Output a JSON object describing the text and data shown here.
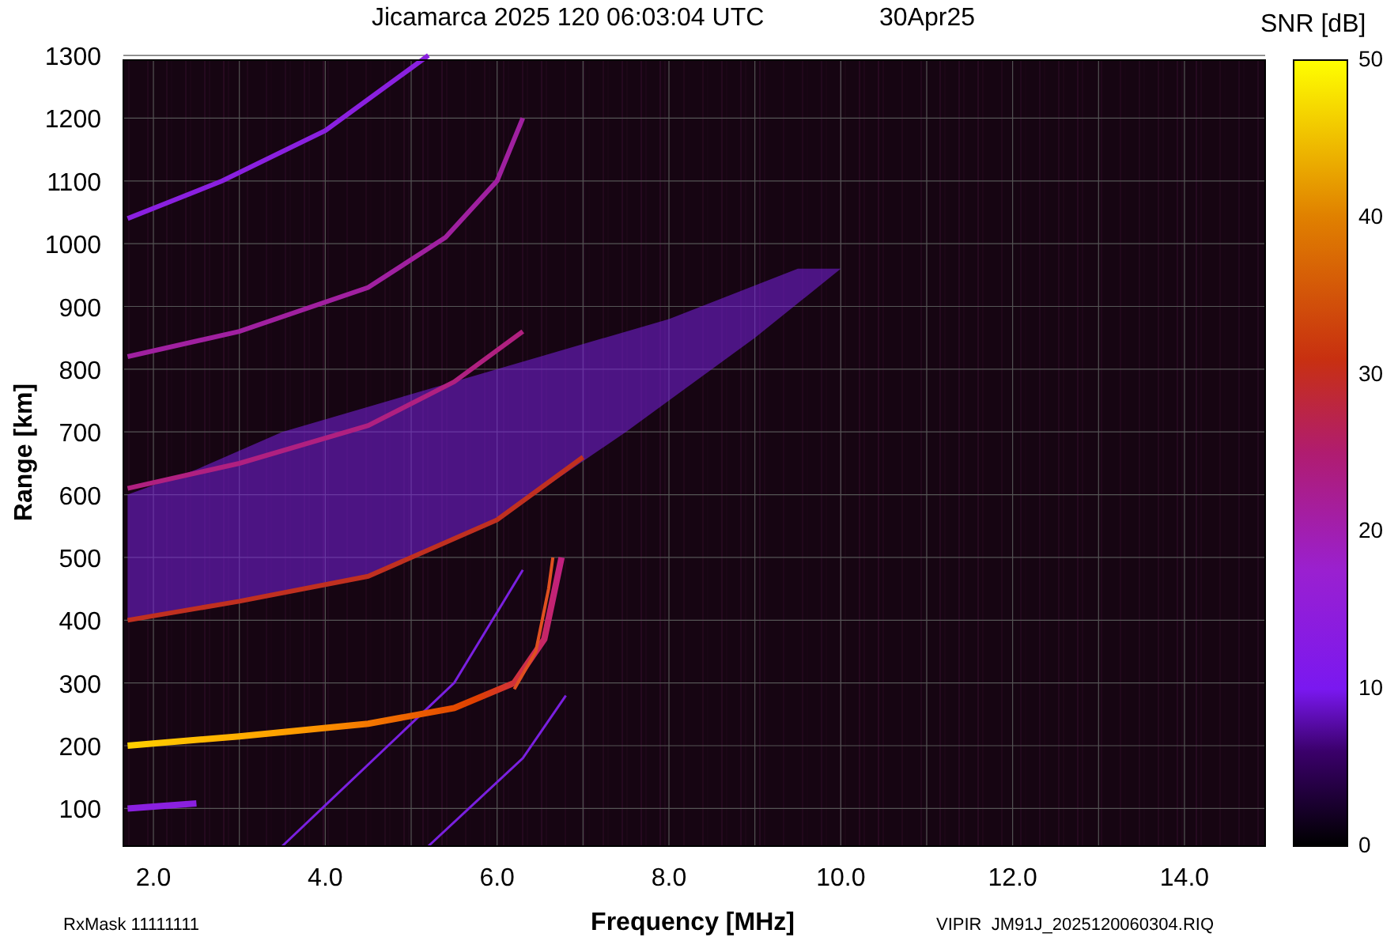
{
  "title": {
    "station_time": "Jicamarca 2025 120 06:03:04 UTC",
    "date": "30Apr25"
  },
  "plot": {
    "y_label": "Range [km]",
    "y_ticks": [
      "1300",
      "1200",
      "1100",
      "1000",
      "900",
      "800",
      "700",
      "600",
      "500",
      "400",
      "300",
      "200",
      "100"
    ],
    "x_label": "Frequency [MHz]",
    "x_ticks": [
      "2.0",
      "4.0",
      "6.0",
      "8.0",
      "10.0",
      "12.0",
      "14.0"
    ]
  },
  "colorbar": {
    "title": "SNR [dB]",
    "ticks": [
      "50",
      "40",
      "30",
      "20",
      "10",
      "0"
    ]
  },
  "footer": {
    "rx_mask": "RxMask 11111111",
    "file": "VIPIR  JM91J_2025120060304.RIQ"
  }
}
